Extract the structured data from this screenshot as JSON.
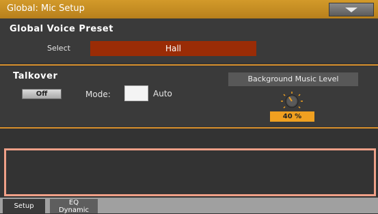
{
  "window": {
    "title": "Global: Mic Setup"
  },
  "global_voice_preset": {
    "heading": "Global Voice Preset",
    "select_label": "Select",
    "select_value": "Hall"
  },
  "talkover": {
    "heading": "Talkover",
    "toggle_label": "Off",
    "mode_label": "Mode:",
    "mode_value": "Auto",
    "bg_music_label": "Background Music Level",
    "bg_music_value": "40 %"
  },
  "tabs": [
    {
      "label": "Setup",
      "active": true
    },
    {
      "label": "EQ\nDynamic",
      "active": false
    }
  ],
  "colors": {
    "title_bar": "#c58d22",
    "preset_field": "#9a2c06",
    "separator": "#d8902c",
    "value_badge": "#f0a020",
    "info_border": "#f0a088"
  },
  "icons": {
    "menu": "triangle-down-icon",
    "knob": "knob-icon"
  }
}
